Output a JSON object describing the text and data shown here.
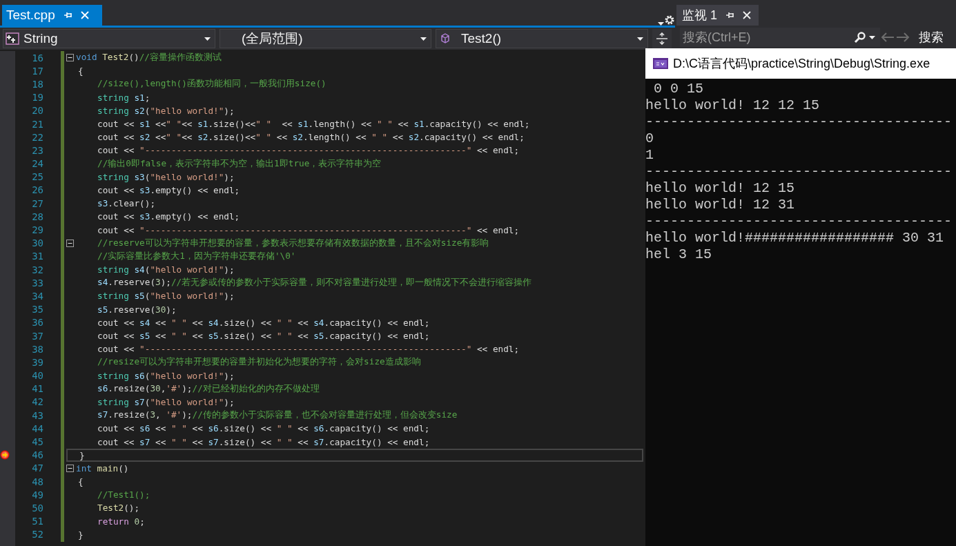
{
  "editor_tab": {
    "title": "Test.cpp",
    "selected": true
  },
  "nav_bar": {
    "project": "String",
    "scope": "(全局范围)",
    "member": "Test2()"
  },
  "code_lines": [
    {
      "number": "16",
      "fold": true,
      "current": false,
      "tokens": [
        {
          "kind": "kw",
          "text": "void "
        },
        {
          "kind": "fn",
          "text": "Test2"
        },
        {
          "kind": "p",
          "text": "()"
        },
        {
          "kind": "cm",
          "text": "//容量操作函数测试"
        }
      ],
      "children": [
        {
          "number": "17",
          "fold": false,
          "current": false,
          "tokens": [
            {
              "kind": "p",
              "text": "{"
            }
          ],
          "children": [
            {
              "number": "18",
              "fold": false,
              "current": false,
              "tokens": [
                {
                  "kind": "cm",
                  "text": "//size(),length()函数功能相同，一般我们用size()"
                }
              ]
            },
            {
              "number": "19",
              "fold": false,
              "current": false,
              "tokens": [
                {
                  "kind": "ty",
                  "text": "string "
                },
                {
                  "kind": "var",
                  "text": "s1"
                },
                {
                  "kind": "p",
                  "text": ";"
                }
              ]
            },
            {
              "number": "20",
              "fold": false,
              "current": false,
              "tokens": [
                {
                  "kind": "ty",
                  "text": "string "
                },
                {
                  "kind": "var",
                  "text": "s2"
                },
                {
                  "kind": "p",
                  "text": "("
                },
                {
                  "kind": "str",
                  "text": "\"hello world!\""
                },
                {
                  "kind": "p",
                  "text": ");"
                }
              ]
            },
            {
              "number": "21",
              "fold": false,
              "current": false,
              "tokens": [
                {
                  "kind": "p",
                  "text": "cout << "
                },
                {
                  "kind": "var",
                  "text": "s1"
                },
                {
                  "kind": "p",
                  "text": " <<"
                },
                {
                  "kind": "str",
                  "text": "\" \""
                },
                {
                  "kind": "p",
                  "text": "<< "
                },
                {
                  "kind": "var",
                  "text": "s1"
                },
                {
                  "kind": "p",
                  "text": ".size()<<"
                },
                {
                  "kind": "str",
                  "text": "\" \""
                },
                {
                  "kind": "p",
                  "text": "  << "
                },
                {
                  "kind": "var",
                  "text": "s1"
                },
                {
                  "kind": "p",
                  "text": ".length() << "
                },
                {
                  "kind": "str",
                  "text": "\" \""
                },
                {
                  "kind": "p",
                  "text": " << "
                },
                {
                  "kind": "var",
                  "text": "s1"
                },
                {
                  "kind": "p",
                  "text": ".capacity() << endl;"
                }
              ]
            },
            {
              "number": "22",
              "fold": false,
              "current": false,
              "tokens": [
                {
                  "kind": "p",
                  "text": "cout << "
                },
                {
                  "kind": "var",
                  "text": "s2"
                },
                {
                  "kind": "p",
                  "text": " <<"
                },
                {
                  "kind": "str",
                  "text": "\" \""
                },
                {
                  "kind": "p",
                  "text": "<< "
                },
                {
                  "kind": "var",
                  "text": "s2"
                },
                {
                  "kind": "p",
                  "text": ".size()<<"
                },
                {
                  "kind": "str",
                  "text": "\" \""
                },
                {
                  "kind": "p",
                  "text": " << "
                },
                {
                  "kind": "var",
                  "text": "s2"
                },
                {
                  "kind": "p",
                  "text": ".length() << "
                },
                {
                  "kind": "str",
                  "text": "\" \""
                },
                {
                  "kind": "p",
                  "text": " << "
                },
                {
                  "kind": "var",
                  "text": "s2"
                },
                {
                  "kind": "p",
                  "text": ".capacity() << endl;"
                }
              ]
            },
            {
              "number": "23",
              "fold": false,
              "current": false,
              "tokens": [
                {
                  "kind": "p",
                  "text": "cout << "
                },
                {
                  "kind": "str",
                  "text": "\"-------------------------------------------------------------\""
                },
                {
                  "kind": "p",
                  "text": " << endl;"
                }
              ]
            },
            {
              "number": "24",
              "fold": false,
              "current": false,
              "tokens": [
                {
                  "kind": "cm",
                  "text": "//输出0即false，表示字符串不为空，输出1即true，表示字符串为空"
                }
              ]
            },
            {
              "number": "25",
              "fold": false,
              "current": false,
              "tokens": [
                {
                  "kind": "ty",
                  "text": "string "
                },
                {
                  "kind": "var",
                  "text": "s3"
                },
                {
                  "kind": "p",
                  "text": "("
                },
                {
                  "kind": "str",
                  "text": "\"hello world!\""
                },
                {
                  "kind": "p",
                  "text": ");"
                }
              ]
            },
            {
              "number": "26",
              "fold": false,
              "current": false,
              "tokens": [
                {
                  "kind": "p",
                  "text": "cout << "
                },
                {
                  "kind": "var",
                  "text": "s3"
                },
                {
                  "kind": "p",
                  "text": ".empty() << endl;"
                }
              ]
            },
            {
              "number": "27",
              "fold": false,
              "current": false,
              "tokens": [
                {
                  "kind": "var",
                  "text": "s3"
                },
                {
                  "kind": "p",
                  "text": ".clear();"
                }
              ]
            },
            {
              "number": "28",
              "fold": false,
              "current": false,
              "tokens": [
                {
                  "kind": "p",
                  "text": "cout << "
                },
                {
                  "kind": "var",
                  "text": "s3"
                },
                {
                  "kind": "p",
                  "text": ".empty() << endl;"
                }
              ]
            },
            {
              "number": "29",
              "fold": false,
              "current": false,
              "tokens": [
                {
                  "kind": "p",
                  "text": "cout << "
                },
                {
                  "kind": "str",
                  "text": "\"-------------------------------------------------------------\""
                },
                {
                  "kind": "p",
                  "text": " << endl;"
                }
              ]
            },
            {
              "number": "30",
              "fold": true,
              "current": false,
              "tokens": [
                {
                  "kind": "cm",
                  "text": "//reserve可以为字符串开想要的容量，参数表示想要存储有效数据的数量，且不会对size有影响"
                }
              ]
            },
            {
              "number": "31",
              "fold": false,
              "current": false,
              "tokens": [
                {
                  "kind": "cm",
                  "text": "//实际容量比参数大1，因为字符串还要存储'\\0'"
                }
              ]
            },
            {
              "number": "32",
              "fold": false,
              "current": false,
              "tokens": [
                {
                  "kind": "ty",
                  "text": "string "
                },
                {
                  "kind": "var",
                  "text": "s4"
                },
                {
                  "kind": "p",
                  "text": "("
                },
                {
                  "kind": "str",
                  "text": "\"hello world!\""
                },
                {
                  "kind": "p",
                  "text": ");"
                }
              ]
            },
            {
              "number": "33",
              "fold": false,
              "current": false,
              "tokens": [
                {
                  "kind": "var",
                  "text": "s4"
                },
                {
                  "kind": "p",
                  "text": ".reserve("
                },
                {
                  "kind": "num",
                  "text": "3"
                },
                {
                  "kind": "p",
                  "text": ");"
                },
                {
                  "kind": "cm",
                  "text": "//若无参或传的参数小于实际容量，则不对容量进行处理，即一般情况下不会进行缩容操作"
                }
              ]
            },
            {
              "number": "34",
              "fold": false,
              "current": false,
              "tokens": [
                {
                  "kind": "ty",
                  "text": "string "
                },
                {
                  "kind": "var",
                  "text": "s5"
                },
                {
                  "kind": "p",
                  "text": "("
                },
                {
                  "kind": "str",
                  "text": "\"hello world!\""
                },
                {
                  "kind": "p",
                  "text": ");"
                }
              ]
            },
            {
              "number": "35",
              "fold": false,
              "current": false,
              "tokens": [
                {
                  "kind": "var",
                  "text": "s5"
                },
                {
                  "kind": "p",
                  "text": ".reserve("
                },
                {
                  "kind": "num",
                  "text": "30"
                },
                {
                  "kind": "p",
                  "text": ");"
                }
              ]
            },
            {
              "number": "36",
              "fold": false,
              "current": false,
              "tokens": [
                {
                  "kind": "p",
                  "text": "cout << "
                },
                {
                  "kind": "var",
                  "text": "s4"
                },
                {
                  "kind": "p",
                  "text": " << "
                },
                {
                  "kind": "str",
                  "text": "\" \""
                },
                {
                  "kind": "p",
                  "text": " << "
                },
                {
                  "kind": "var",
                  "text": "s4"
                },
                {
                  "kind": "p",
                  "text": ".size() << "
                },
                {
                  "kind": "str",
                  "text": "\" \""
                },
                {
                  "kind": "p",
                  "text": " << "
                },
                {
                  "kind": "var",
                  "text": "s4"
                },
                {
                  "kind": "p",
                  "text": ".capacity() << endl;"
                }
              ]
            },
            {
              "number": "37",
              "fold": false,
              "current": false,
              "tokens": [
                {
                  "kind": "p",
                  "text": "cout << "
                },
                {
                  "kind": "var",
                  "text": "s5"
                },
                {
                  "kind": "p",
                  "text": " << "
                },
                {
                  "kind": "str",
                  "text": "\" \""
                },
                {
                  "kind": "p",
                  "text": " << "
                },
                {
                  "kind": "var",
                  "text": "s5"
                },
                {
                  "kind": "p",
                  "text": ".size() << "
                },
                {
                  "kind": "str",
                  "text": "\" \""
                },
                {
                  "kind": "p",
                  "text": " << "
                },
                {
                  "kind": "var",
                  "text": "s5"
                },
                {
                  "kind": "p",
                  "text": ".capacity() << endl;"
                }
              ]
            },
            {
              "number": "38",
              "fold": false,
              "current": false,
              "tokens": [
                {
                  "kind": "p",
                  "text": "cout << "
                },
                {
                  "kind": "str",
                  "text": "\"-------------------------------------------------------------\""
                },
                {
                  "kind": "p",
                  "text": " << endl;"
                }
              ]
            },
            {
              "number": "39",
              "fold": false,
              "current": false,
              "tokens": [
                {
                  "kind": "cm",
                  "text": "//resize可以为字符串开想要的容量并初始化为想要的字符，会对size造成影响"
                }
              ]
            },
            {
              "number": "40",
              "fold": false,
              "current": false,
              "tokens": [
                {
                  "kind": "ty",
                  "text": "string "
                },
                {
                  "kind": "var",
                  "text": "s6"
                },
                {
                  "kind": "p",
                  "text": "("
                },
                {
                  "kind": "str",
                  "text": "\"hello world!\""
                },
                {
                  "kind": "p",
                  "text": ");"
                }
              ]
            },
            {
              "number": "41",
              "fold": false,
              "current": false,
              "tokens": [
                {
                  "kind": "var",
                  "text": "s6"
                },
                {
                  "kind": "p",
                  "text": ".resize("
                },
                {
                  "kind": "num",
                  "text": "30"
                },
                {
                  "kind": "p",
                  "text": ","
                },
                {
                  "kind": "str",
                  "text": "'#'"
                },
                {
                  "kind": "p",
                  "text": ");"
                },
                {
                  "kind": "cm",
                  "text": "//对已经初始化的内存不做处理"
                }
              ]
            },
            {
              "number": "42",
              "fold": false,
              "current": false,
              "tokens": [
                {
                  "kind": "ty",
                  "text": "string "
                },
                {
                  "kind": "var",
                  "text": "s7"
                },
                {
                  "kind": "p",
                  "text": "("
                },
                {
                  "kind": "str",
                  "text": "\"hello world!\""
                },
                {
                  "kind": "p",
                  "text": ");"
                }
              ]
            },
            {
              "number": "43",
              "fold": false,
              "current": false,
              "tokens": [
                {
                  "kind": "var",
                  "text": "s7"
                },
                {
                  "kind": "p",
                  "text": ".resize("
                },
                {
                  "kind": "num",
                  "text": "3"
                },
                {
                  "kind": "p",
                  "text": ", "
                },
                {
                  "kind": "str",
                  "text": "'#'"
                },
                {
                  "kind": "p",
                  "text": ");"
                },
                {
                  "kind": "cm",
                  "text": "//传的参数小于实际容量，也不会对容量进行处理，但会改变size"
                }
              ]
            },
            {
              "number": "44",
              "fold": false,
              "current": false,
              "tokens": [
                {
                  "kind": "p",
                  "text": "cout << "
                },
                {
                  "kind": "var",
                  "text": "s6"
                },
                {
                  "kind": "p",
                  "text": " << "
                },
                {
                  "kind": "str",
                  "text": "\" \""
                },
                {
                  "kind": "p",
                  "text": " << "
                },
                {
                  "kind": "var",
                  "text": "s6"
                },
                {
                  "kind": "p",
                  "text": ".size() << "
                },
                {
                  "kind": "str",
                  "text": "\" \""
                },
                {
                  "kind": "p",
                  "text": " << "
                },
                {
                  "kind": "var",
                  "text": "s6"
                },
                {
                  "kind": "p",
                  "text": ".capacity() << endl;"
                }
              ]
            },
            {
              "number": "45",
              "fold": false,
              "current": false,
              "tokens": [
                {
                  "kind": "p",
                  "text": "cout << "
                },
                {
                  "kind": "var",
                  "text": "s7"
                },
                {
                  "kind": "p",
                  "text": " << "
                },
                {
                  "kind": "str",
                  "text": "\" \""
                },
                {
                  "kind": "p",
                  "text": " << "
                },
                {
                  "kind": "var",
                  "text": "s7"
                },
                {
                  "kind": "p",
                  "text": ".size() << "
                },
                {
                  "kind": "str",
                  "text": "\" \""
                },
                {
                  "kind": "p",
                  "text": " << "
                },
                {
                  "kind": "var",
                  "text": "s7"
                },
                {
                  "kind": "p",
                  "text": ".capacity() << endl;"
                }
              ]
            }
          ]
        },
        {
          "number": "46",
          "fold": false,
          "current": true,
          "tokens": [
            {
              "kind": "p",
              "text": "}"
            }
          ]
        }
      ]
    },
    {
      "number": "47",
      "fold": true,
      "current": false,
      "tokens": [
        {
          "kind": "kw",
          "text": "int "
        },
        {
          "kind": "fn",
          "text": "main"
        },
        {
          "kind": "p",
          "text": "()"
        }
      ],
      "children": [
        {
          "number": "48",
          "fold": false,
          "current": false,
          "tokens": [
            {
              "kind": "p",
              "text": "{"
            }
          ],
          "children": [
            {
              "number": "49",
              "fold": false,
              "current": false,
              "tokens": [
                {
                  "kind": "cm",
                  "text": "//Test1();"
                }
              ]
            },
            {
              "number": "50",
              "fold": false,
              "current": false,
              "tokens": [
                {
                  "kind": "fn",
                  "text": "Test2"
                },
                {
                  "kind": "p",
                  "text": "();"
                }
              ]
            },
            {
              "number": "51",
              "fold": false,
              "current": false,
              "tokens": [
                {
                  "kind": "ctl",
                  "text": "return "
                },
                {
                  "kind": "num",
                  "text": "0"
                },
                {
                  "kind": "p",
                  "text": ";"
                }
              ]
            }
          ]
        },
        {
          "number": "52",
          "fold": false,
          "current": false,
          "tokens": [
            {
              "kind": "p",
              "text": "}"
            }
          ]
        }
      ]
    }
  ],
  "watch_panel": {
    "tab": {
      "title": "监视 1",
      "selected": false
    },
    "search": {
      "placeholder": "搜索(Ctrl+E)"
    },
    "search_depth_label": "搜索"
  },
  "console": {
    "title": "D:\\C语言代码\\practice\\String\\Debug\\String.exe",
    "output": [
      " 0 0 15",
      "hello world! 12 12 15",
      "-------------------------------------",
      "0",
      "1",
      "-------------------------------------",
      "hello world! 12 15",
      "hello world! 12 31",
      "-------------------------------------",
      "hello world!################## 30 31",
      "hel 3 15"
    ]
  }
}
